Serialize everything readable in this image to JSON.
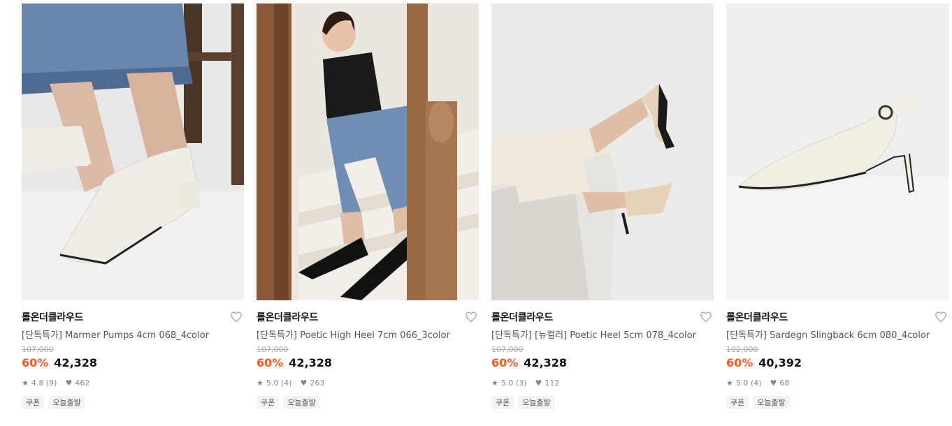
{
  "products": [
    {
      "brand": "롤온더클라우드",
      "title": "[단독특가] Marmer Pumps 4cm 068_4color",
      "original_price": "107,000",
      "discount": "60%",
      "price": "42,328",
      "rating": "4.8 (9)",
      "likes": "462",
      "tags": [
        "쿠폰",
        "오늘출발"
      ]
    },
    {
      "brand": "롤온더클라우드",
      "title": "[단독특가] Poetic High Heel 7cm 066_3color",
      "original_price": "107,000",
      "discount": "60%",
      "price": "42,328",
      "rating": "5.0 (4)",
      "likes": "263",
      "tags": [
        "쿠폰",
        "오늘출발"
      ]
    },
    {
      "brand": "롤온더클라우드",
      "title": "[단독특가] [뉴컬러] Poetic Heel 5cm 078_4color",
      "original_price": "107,000",
      "discount": "60%",
      "price": "42,328",
      "rating": "5.0 (3)",
      "likes": "112",
      "tags": [
        "쿠폰",
        "오늘출발"
      ]
    },
    {
      "brand": "롤온더클라우드",
      "title": "[단독특가] Sardegn Slingback 6cm 080_4color",
      "original_price": "102,000",
      "discount": "60%",
      "price": "40,392",
      "rating": "5.0 (4)",
      "likes": "68",
      "tags": [
        "쿠폰",
        "오늘출발"
      ]
    }
  ],
  "colors": {
    "discount": "#ff5a1f",
    "text": "#111111",
    "muted": "#888888"
  }
}
